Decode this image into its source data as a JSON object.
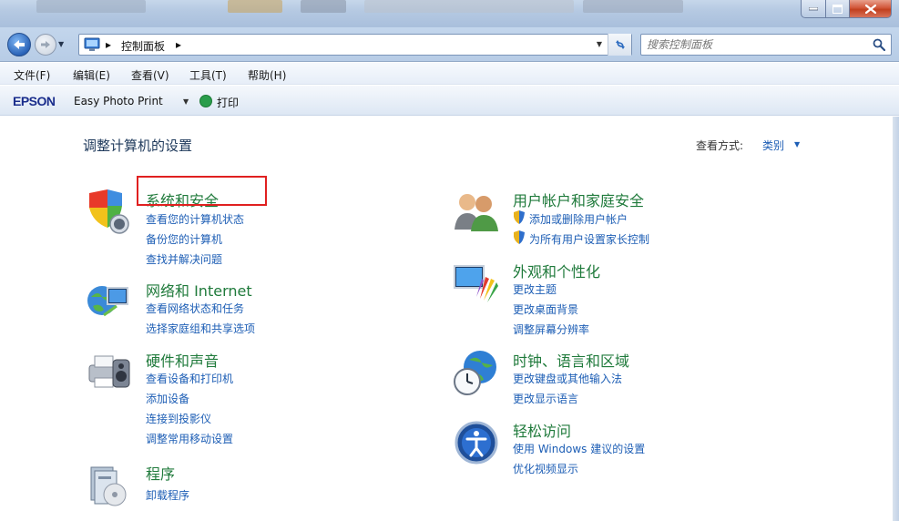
{
  "address": {
    "crumb": "控制面板",
    "search_placeholder": "搜索控制面板"
  },
  "menu": [
    "文件(F)",
    "编辑(E)",
    "查看(V)",
    "工具(T)",
    "帮助(H)"
  ],
  "epson": {
    "logo": "EPSON",
    "app": "Easy Photo Print",
    "print": "打印"
  },
  "page": {
    "title": "调整计算机的设置",
    "viewby_label": "查看方式:",
    "viewby_value": "类别"
  },
  "categories": {
    "system": {
      "title": "系统和安全",
      "links": [
        "查看您的计算机状态",
        "备份您的计算机",
        "查找并解决问题"
      ]
    },
    "network": {
      "title": "网络和 Internet",
      "links": [
        "查看网络状态和任务",
        "选择家庭组和共享选项"
      ]
    },
    "hardware": {
      "title": "硬件和声音",
      "links": [
        "查看设备和打印机",
        "添加设备",
        "连接到投影仪",
        "调整常用移动设置"
      ]
    },
    "programs": {
      "title": "程序",
      "links": [
        "卸载程序"
      ]
    },
    "users": {
      "title": "用户帐户和家庭安全",
      "links": [
        "添加或删除用户帐户",
        "为所有用户设置家长控制"
      ]
    },
    "appearance": {
      "title": "外观和个性化",
      "links": [
        "更改主题",
        "更改桌面背景",
        "调整屏幕分辨率"
      ]
    },
    "clock": {
      "title": "时钟、语言和区域",
      "links": [
        "更改键盘或其他输入法",
        "更改显示语言"
      ]
    },
    "ease": {
      "title": "轻松访问",
      "links": [
        "使用 Windows 建议的设置",
        "优化视频显示"
      ]
    }
  }
}
